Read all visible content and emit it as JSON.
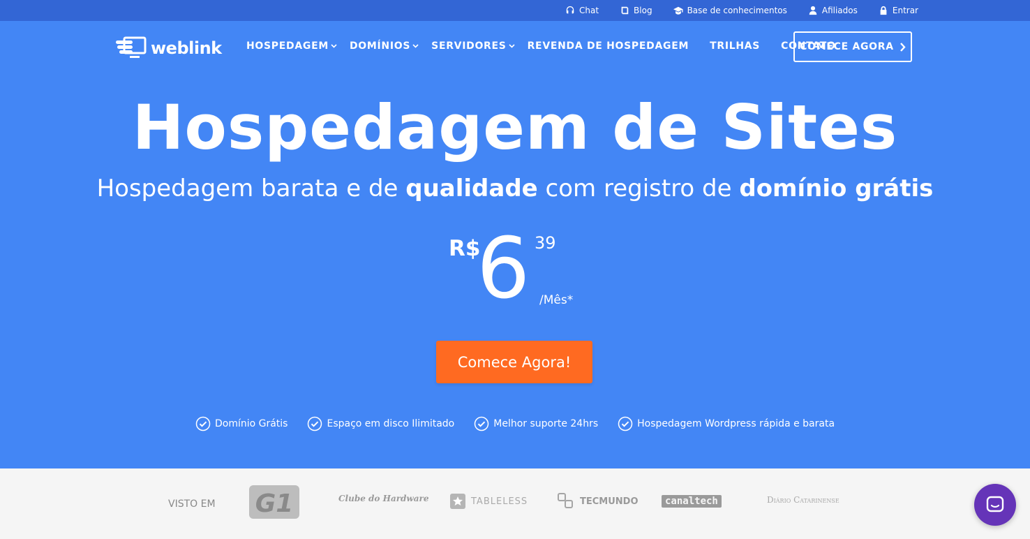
{
  "topbar": {
    "links": [
      {
        "label": "Chat",
        "icon": "headset-icon"
      },
      {
        "label": "Blog",
        "icon": "book-icon"
      },
      {
        "label": "Base de conhecimentos",
        "icon": "graduation-cap-icon"
      },
      {
        "label": "Afiliados",
        "icon": "user-icon"
      },
      {
        "label": "Entrar",
        "icon": "lock-icon"
      }
    ]
  },
  "brand": {
    "name": "weblink",
    "logo_icon": "stacked-monitor-logo"
  },
  "nav": {
    "items": [
      {
        "label": "HOSPEDAGEM",
        "has_dropdown": true
      },
      {
        "label": "DOMÍNIOS",
        "has_dropdown": true
      },
      {
        "label": "SERVIDORES",
        "has_dropdown": true
      },
      {
        "label": "REVENDA DE HOSPEDAGEM",
        "has_dropdown": false
      },
      {
        "label": "TRILHAS",
        "has_dropdown": false
      },
      {
        "label": "CONTATO",
        "has_dropdown": false
      }
    ],
    "cta_label": "COMECE AGORA"
  },
  "hero": {
    "title": "Hospedagem de Sites",
    "subtitle_parts": [
      "Hospedagem barata e de ",
      "qualidade",
      " com registro de ",
      "domínio grátis"
    ],
    "price": {
      "currency": "R$",
      "integer": "6",
      "cents": "39",
      "period": "/Mês*"
    },
    "cta_label": "Comece Agora!",
    "features": [
      "Domínio Grátis",
      "Espaço em disco Ilimitado",
      "Melhor suporte 24hrs",
      "Hospedagem Wordpress rápida e barata"
    ]
  },
  "press": {
    "label": "VISTO EM",
    "logos": [
      "G1",
      "Clube do Hardware",
      "TABLELESS",
      "TECMUNDO",
      "canaltech",
      "Diário Catarinense"
    ]
  },
  "colors": {
    "hero_bg": "#4386f5",
    "topbar_bg": "#3366d5",
    "cta_orange": "#ff6a21",
    "press_bg": "#f5f5f5",
    "chat_purple": "#6534b8"
  },
  "chat_widget": {
    "icon": "chat-bubble-icon"
  }
}
